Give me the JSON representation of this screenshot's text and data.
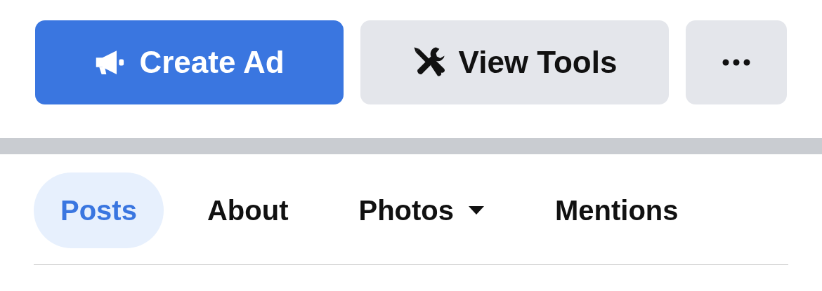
{
  "actions": [
    {
      "kind": "primary",
      "label": "Create Ad"
    },
    {
      "kind": "secondary",
      "label": "View Tools"
    },
    {
      "kind": "more"
    }
  ],
  "tabs": [
    {
      "label": "Posts",
      "selected": true,
      "has_menu": false
    },
    {
      "label": "About",
      "selected": false,
      "has_menu": false
    },
    {
      "label": "Photos",
      "selected": false,
      "has_menu": true
    },
    {
      "label": "Mentions",
      "selected": false,
      "has_menu": false
    }
  ]
}
